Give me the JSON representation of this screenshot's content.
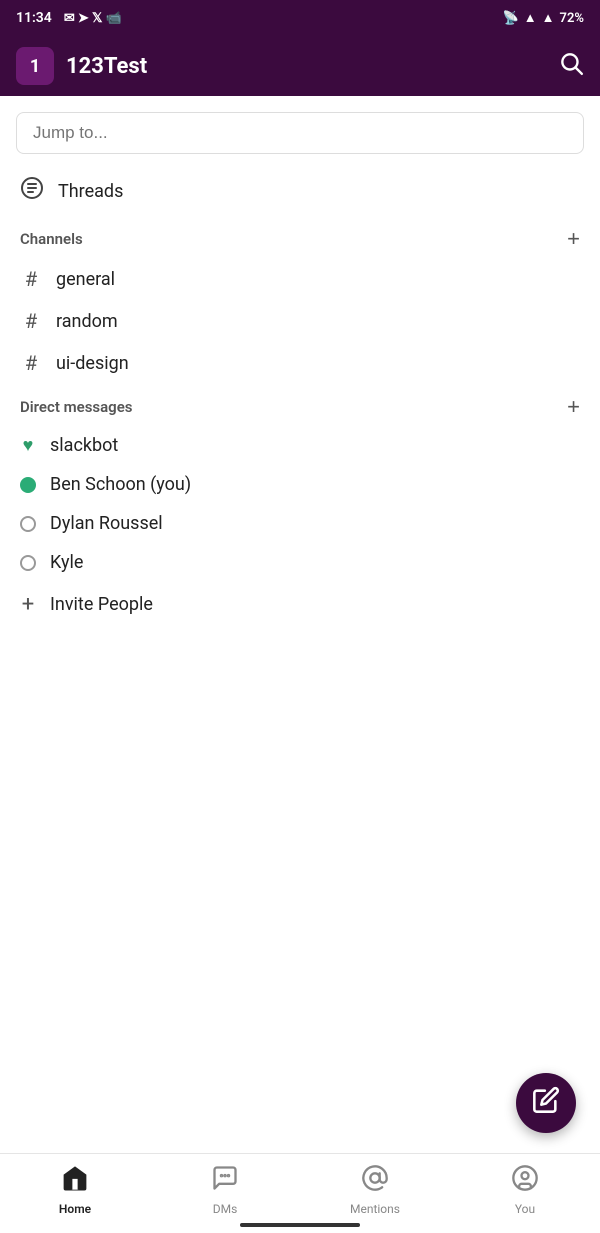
{
  "statusBar": {
    "time": "11:34",
    "battery": "72%"
  },
  "topBar": {
    "badgeNumber": "1",
    "workspaceName": "123Test"
  },
  "jumpTo": {
    "placeholder": "Jump to..."
  },
  "threads": {
    "label": "Threads"
  },
  "channels": {
    "sectionTitle": "Channels",
    "addLabel": "+",
    "items": [
      {
        "name": "general"
      },
      {
        "name": "random"
      },
      {
        "name": "ui-design"
      }
    ]
  },
  "directMessages": {
    "sectionTitle": "Direct messages",
    "addLabel": "+",
    "items": [
      {
        "name": "slackbot",
        "status": "heart"
      },
      {
        "name": "Ben Schoon (you)",
        "status": "online"
      },
      {
        "name": "Dylan Roussel",
        "status": "offline"
      },
      {
        "name": "Kyle",
        "status": "offline"
      }
    ]
  },
  "invitePeople": {
    "label": "Invite People"
  },
  "bottomNav": {
    "items": [
      {
        "label": "Home",
        "active": true
      },
      {
        "label": "DMs",
        "active": false
      },
      {
        "label": "Mentions",
        "active": false
      },
      {
        "label": "You",
        "active": false
      }
    ]
  }
}
